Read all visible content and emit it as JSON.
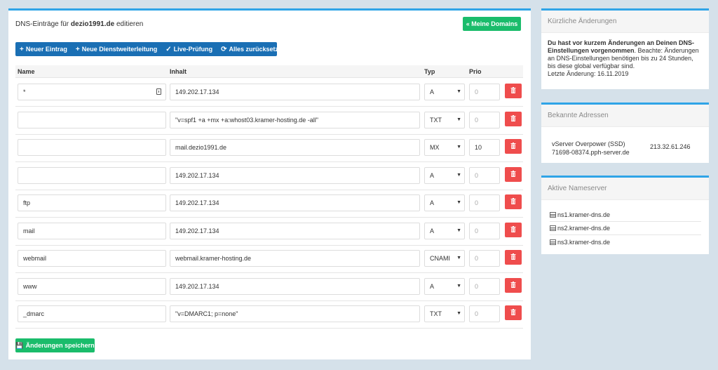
{
  "main": {
    "title_prefix": "DNS-Einträge für",
    "title_domain": "dezio1991.de",
    "title_suffix": "editieren",
    "domains_button": "« Meine Domains",
    "toolbar": {
      "new_entry": "Neuer Eintrag",
      "new_forward": "Neue Dienstweiterleitung",
      "live_check": "Live-Prüfung",
      "reset_all": "Alles zurücksetzen"
    },
    "columns": {
      "name": "Name",
      "content": "Inhalt",
      "type": "Typ",
      "prio": "Prio"
    },
    "prio_placeholder": "0",
    "rows": [
      {
        "name": "*",
        "content": "149.202.17.134",
        "type": "A",
        "prio": ""
      },
      {
        "name": "",
        "content": "\"v=spf1 +a +mx +a:whost03.kramer-hosting.de -all\"",
        "type": "TXT",
        "prio": ""
      },
      {
        "name": "",
        "content": "mail.dezio1991.de",
        "type": "MX",
        "prio": "10"
      },
      {
        "name": "",
        "content": "149.202.17.134",
        "type": "A",
        "prio": ""
      },
      {
        "name": "ftp",
        "content": "149.202.17.134",
        "type": "A",
        "prio": ""
      },
      {
        "name": "mail",
        "content": "149.202.17.134",
        "type": "A",
        "prio": ""
      },
      {
        "name": "webmail",
        "content": "webmail.kramer-hosting.de",
        "type": "CNAMI",
        "prio": ""
      },
      {
        "name": "www",
        "content": "149.202.17.134",
        "type": "A",
        "prio": ""
      },
      {
        "name": "_dmarc",
        "content": "\"v=DMARC1; p=none\"",
        "type": "TXT",
        "prio": ""
      }
    ],
    "save_button": "Änderungen speichern"
  },
  "recent": {
    "title": "Kürzliche Änderungen",
    "bold_text": "Du hast vor kurzem Änderungen an Deinen DNS-Einstellungen vorgenommen",
    "rest_text": ". Beachte: Änderungen an DNS-Einstellungen benötigen bis zu 24 Stunden, bis diese global verfügbar sind.",
    "last_change": "Letzte Änderung: 16.11.2019"
  },
  "known": {
    "title": "Bekannte Adressen",
    "server_name": "vServer Overpower (SSD)",
    "server_host": "71698-08374.pph-server.de",
    "server_ip": "213.32.61.246"
  },
  "nameservers": {
    "title": "Aktive Nameserver",
    "items": [
      "ns1.kramer-dns.de",
      "ns2.kramer-dns.de",
      "ns3.kramer-dns.de"
    ]
  },
  "colors": {
    "accent": "#2fa4e7",
    "primary": "#1a6fb4",
    "success": "#1abc6b",
    "danger": "#ef4d4d"
  }
}
